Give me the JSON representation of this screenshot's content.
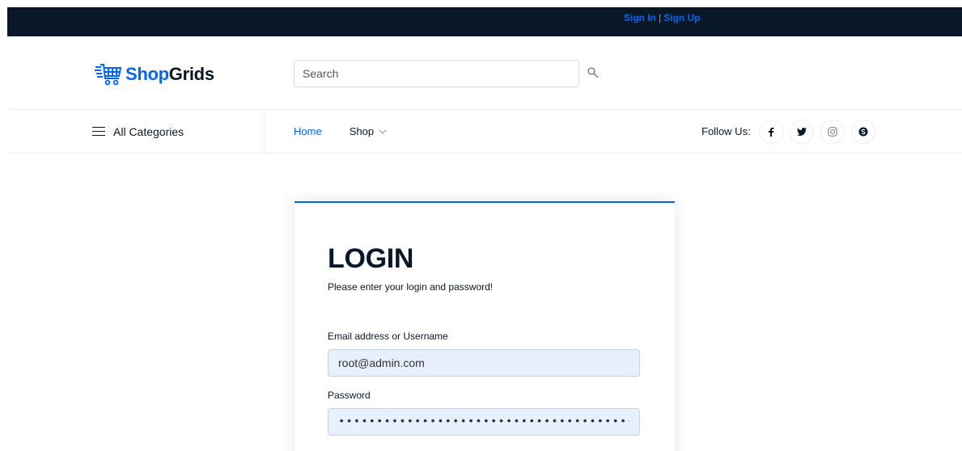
{
  "topbar": {
    "sign_in": "Sign In",
    "separator": "|",
    "sign_up": "Sign Up"
  },
  "brand": {
    "part1": "Shop",
    "part2": "Grids",
    "logo_icon": "shopping-cart-icon",
    "primary_color": "#0167f3",
    "dark_color": "#081828"
  },
  "search": {
    "placeholder": "Search",
    "value": "",
    "icon": "search-icon"
  },
  "nav": {
    "categories_label": "All Categories",
    "categories_icon": "hamburger-icon",
    "links": [
      {
        "label": "Home",
        "active": true
      },
      {
        "label": "Shop",
        "dropdown": true
      }
    ],
    "follow_label": "Follow Us:",
    "socials": [
      "facebook-icon",
      "twitter-icon",
      "instagram-icon",
      "skype-icon"
    ]
  },
  "login": {
    "title": "LOGIN",
    "subtitle": "Please enter your login and password!",
    "email_label": "Email address or Username",
    "email_value": "root@admin.com",
    "password_label": "Password",
    "password_value": "••••••••••••••••••••••••••••••••••••••••"
  }
}
